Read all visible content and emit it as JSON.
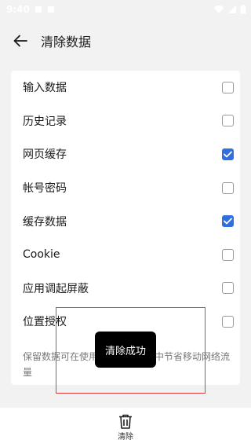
{
  "status_bar": {
    "time": "9:40"
  },
  "header": {
    "title": "清除数据"
  },
  "options": [
    {
      "label": "输入数据",
      "checked": false
    },
    {
      "label": "历史记录",
      "checked": false
    },
    {
      "label": "网页缓存",
      "checked": true
    },
    {
      "label": "帐号密码",
      "checked": false
    },
    {
      "label": "缓存数据",
      "checked": true
    },
    {
      "label": "Cookie",
      "checked": false
    },
    {
      "label": "应用调起屏蔽",
      "checked": false
    },
    {
      "label": "位置授权",
      "checked": false
    }
  ],
  "footnote": "保留数据可在使用浏览器的过程中节省移动网络流量",
  "bottom": {
    "clear_label": "清除"
  },
  "toast": {
    "message": "清除成功"
  },
  "colors": {
    "accent": "#2f6fde",
    "highlight": "#e23d3d"
  }
}
